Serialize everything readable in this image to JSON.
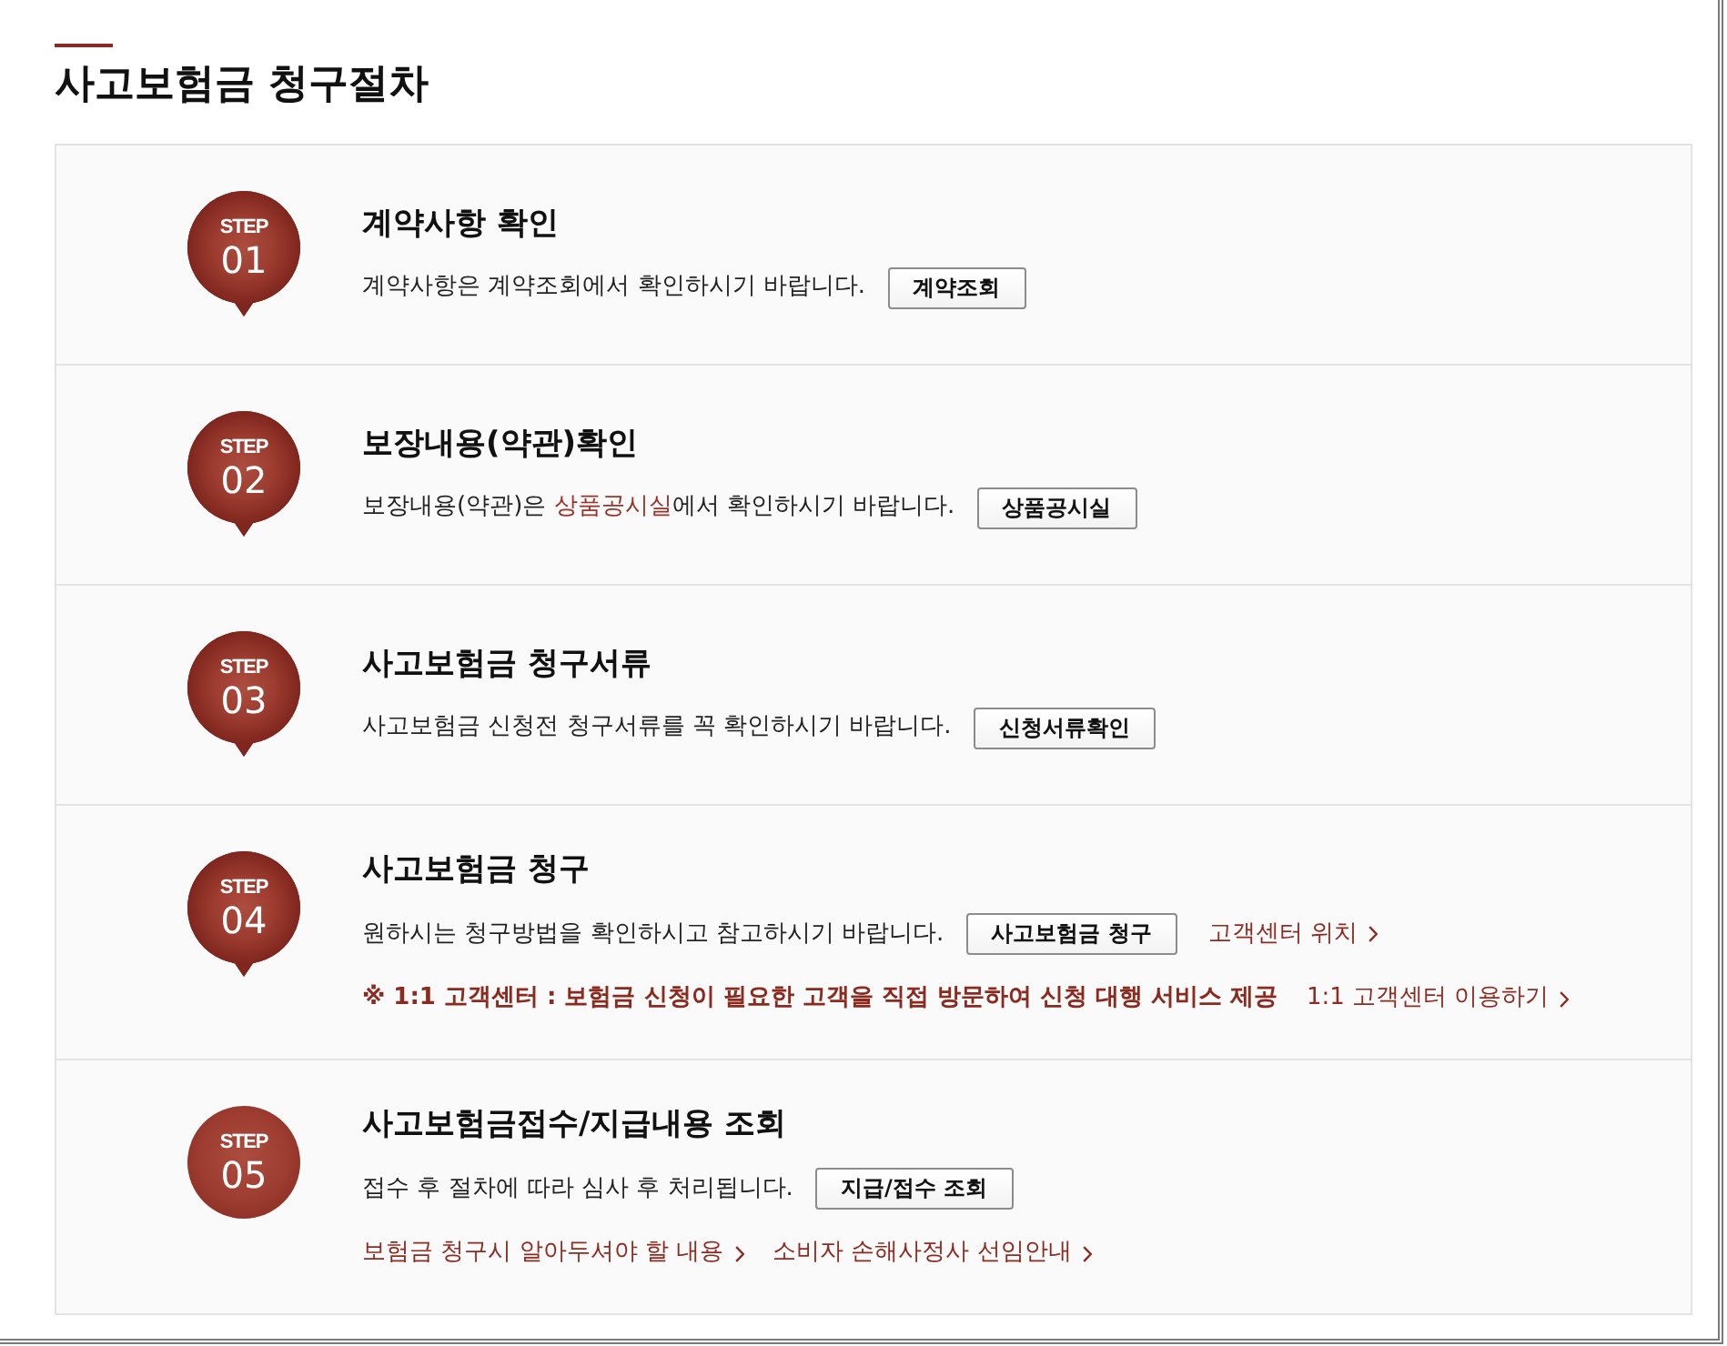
{
  "page": {
    "title": "사고보험금 청구절차"
  },
  "steps": [
    {
      "label": "STEP",
      "number": "01",
      "pointer": true,
      "title": "계약사항 확인",
      "description": [
        {
          "kind": "text",
          "text": "계약사항은 계약조회에서 확인하시기 바랍니다."
        }
      ],
      "actions": [
        {
          "kind": "button",
          "text": "계약조회"
        }
      ]
    },
    {
      "label": "STEP",
      "number": "02",
      "pointer": true,
      "title": "보장내용(약관)확인",
      "description": [
        {
          "kind": "text",
          "text": "보장내용(약관)은 "
        },
        {
          "kind": "link",
          "text": "상품공시실"
        },
        {
          "kind": "text",
          "text": "에서 확인하시기 바랍니다."
        }
      ],
      "actions": [
        {
          "kind": "button",
          "text": "상품공시실"
        }
      ]
    },
    {
      "label": "STEP",
      "number": "03",
      "pointer": true,
      "title": "사고보험금 청구서류",
      "description": [
        {
          "kind": "text",
          "text": "사고보험금 신청전 청구서류를 꼭 확인하시기 바랍니다."
        }
      ],
      "actions": [
        {
          "kind": "button",
          "text": "신청서류확인"
        }
      ]
    },
    {
      "label": "STEP",
      "number": "04",
      "pointer": true,
      "title": "사고보험금 청구",
      "description": [
        {
          "kind": "text",
          "text": "원하시는 청구방법을 확인하시고 참고하시기 바랍니다."
        }
      ],
      "actions": [
        {
          "kind": "button",
          "text": "사고보험금 청구"
        },
        {
          "kind": "link",
          "text": "고객센터 위치"
        }
      ],
      "extra_lines": [
        [
          {
            "kind": "note",
            "text": "※ 1:1 고객센터 : 보험금 신청이 필요한 고객을 직접 방문하여 신청 대행 서비스 제공"
          },
          {
            "kind": "link",
            "text": "1:1 고객센터 이용하기"
          }
        ]
      ]
    },
    {
      "label": "STEP",
      "number": "05",
      "pointer": false,
      "title": "사고보험금접수/지급내용 조회",
      "description": [
        {
          "kind": "text",
          "text": "접수 후 절차에 따라 심사 후 처리됩니다."
        }
      ],
      "actions": [
        {
          "kind": "button",
          "text": "지급/접수 조회"
        }
      ],
      "extra_lines": [
        [
          {
            "kind": "link",
            "text": "보험금 청구시 알아두셔야 할 내용"
          },
          {
            "kind": "link",
            "text": "소비자 손해사정사 선임안내"
          }
        ]
      ]
    }
  ]
}
